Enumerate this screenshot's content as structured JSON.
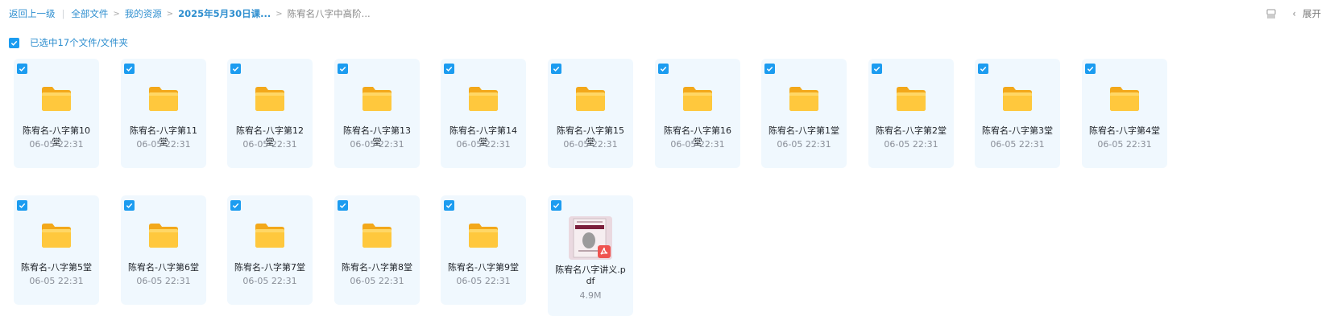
{
  "breadcrumb": {
    "back": "返回上一级",
    "items": [
      "全部文件",
      "我的资源",
      "2025年5月30日课...",
      "陈宥名八字中高阶..."
    ]
  },
  "toolbar": {
    "expand_label": "展开"
  },
  "selection": {
    "label": "已选中17个文件/文件夹"
  },
  "files": [
    {
      "name": "陈宥名-八字第10堂",
      "meta": "06-05 22:31",
      "type": "folder"
    },
    {
      "name": "陈宥名-八字第11堂",
      "meta": "06-05 22:31",
      "type": "folder"
    },
    {
      "name": "陈宥名-八字第12堂",
      "meta": "06-05 22:31",
      "type": "folder"
    },
    {
      "name": "陈宥名-八字第13堂",
      "meta": "06-05 22:31",
      "type": "folder"
    },
    {
      "name": "陈宥名-八字第14堂",
      "meta": "06-05 22:31",
      "type": "folder"
    },
    {
      "name": "陈宥名-八字第15堂",
      "meta": "06-05 22:31",
      "type": "folder"
    },
    {
      "name": "陈宥名-八字第16堂",
      "meta": "06-05 22:31",
      "type": "folder"
    },
    {
      "name": "陈宥名-八字第1堂",
      "meta": "06-05 22:31",
      "type": "folder"
    },
    {
      "name": "陈宥名-八字第2堂",
      "meta": "06-05 22:31",
      "type": "folder"
    },
    {
      "name": "陈宥名-八字第3堂",
      "meta": "06-05 22:31",
      "type": "folder"
    },
    {
      "name": "陈宥名-八字第4堂",
      "meta": "06-05 22:31",
      "type": "folder"
    },
    {
      "name": "陈宥名-八字第5堂",
      "meta": "06-05 22:31",
      "type": "folder"
    },
    {
      "name": "陈宥名-八字第6堂",
      "meta": "06-05 22:31",
      "type": "folder"
    },
    {
      "name": "陈宥名-八字第7堂",
      "meta": "06-05 22:31",
      "type": "folder"
    },
    {
      "name": "陈宥名-八字第8堂",
      "meta": "06-05 22:31",
      "type": "folder"
    },
    {
      "name": "陈宥名-八字第9堂",
      "meta": "06-05 22:31",
      "type": "folder"
    },
    {
      "name": "陈宥名八字讲义.pdf",
      "meta": "4.9M",
      "type": "pdf"
    }
  ],
  "colors": {
    "accent": "#1c9cf0",
    "link": "#2d8ecf",
    "card_bg": "#f0f8fe",
    "folder": "#ffc83d"
  },
  "icons": {
    "list_view": "list-view-icon",
    "chevron": "chevron-left-icon",
    "checkbox": "checkbox-checked-icon",
    "folder": "folder-icon",
    "pdf": "pdf-thumbnail"
  }
}
